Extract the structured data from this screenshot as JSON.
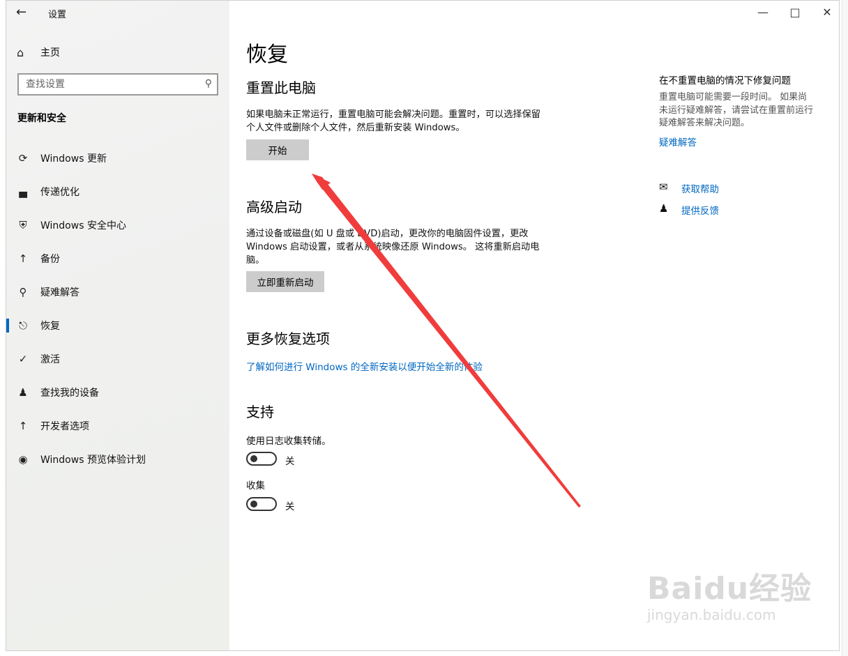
{
  "window": {
    "title": "设置"
  },
  "sidebar": {
    "home_label": "主页",
    "search_placeholder": "查找设置",
    "section_title": "更新和安全",
    "items": [
      {
        "label": "Windows 更新",
        "icon": "sync-icon"
      },
      {
        "label": "传递优化",
        "icon": "delivery-optimization-icon"
      },
      {
        "label": "Windows 安全中心",
        "icon": "shield-icon"
      },
      {
        "label": "备份",
        "icon": "backup-arrow-icon"
      },
      {
        "label": "疑难解答",
        "icon": "wrench-icon"
      },
      {
        "label": "恢复",
        "icon": "recovery-icon",
        "active": true
      },
      {
        "label": "激活",
        "icon": "check-circle-icon"
      },
      {
        "label": "查找我的设备",
        "icon": "find-device-icon"
      },
      {
        "label": "开发者选项",
        "icon": "developer-tools-icon"
      },
      {
        "label": "Windows 预览体验计划",
        "icon": "insider-cat-icon"
      }
    ]
  },
  "main": {
    "title": "恢复",
    "reset": {
      "heading": "重置此电脑",
      "desc_line1": "如果电脑未正常运行，重置电脑可能会解决问题。重置时，可以选择保留",
      "desc_line2": "个人文件或删除个人文件，然后重新安装 Windows。",
      "button": "开始"
    },
    "advanced": {
      "heading": "高级启动",
      "desc_line1": "通过设备或磁盘(如 U 盘或 DVD)启动，更改你的电脑固件设置，更改",
      "desc_line2": "Windows 启动设置，或者从系统映像还原 Windows。 这将重新启动电",
      "desc_line3": "脑。",
      "button": "立即重新启动"
    },
    "more": {
      "heading": "更多恢复选项",
      "link": "了解如何进行 Windows 的全新安装以便开始全新的体验"
    },
    "support": {
      "heading": "支持",
      "log_label": "使用日志收集转储。",
      "log_state": "关",
      "collect_label": "收集",
      "collect_state": "关"
    }
  },
  "right": {
    "title": "在不重置电脑的情况下修复问题",
    "desc_line1": "重置电脑可能需要一段时间。 如果尚",
    "desc_line2": "未运行疑难解答，请尝试在重置前运行",
    "desc_line3": "疑难解答来解决问题。",
    "troubleshoot_link": "疑难解答",
    "help_link": "获取帮助",
    "feedback_link": "提供反馈"
  },
  "watermark": {
    "line1": "Baidu经验",
    "line2": "jingyan.baidu.com"
  },
  "colors": {
    "accent": "#0067c0",
    "arrow": "#f03c3c",
    "button": "#cccccc"
  }
}
